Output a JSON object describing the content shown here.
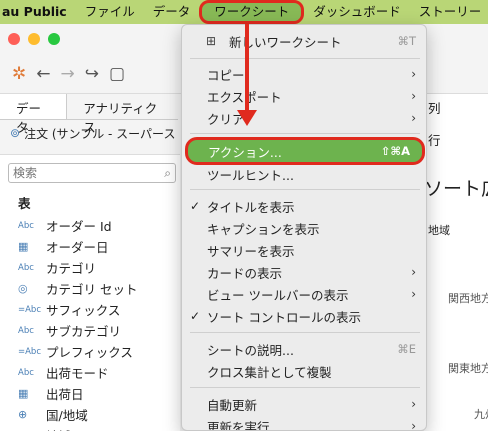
{
  "menubar": {
    "app": "au Public",
    "items": [
      "ファイル",
      "データ",
      "ワークシート",
      "ダッシュボード",
      "ストーリー",
      "ク"
    ]
  },
  "tabs": [
    "データ",
    "アナリティクス"
  ],
  "datasource": "注文 (サンプル - スーパース",
  "search": {
    "placeholder": "検索"
  },
  "section": "表",
  "fields": [
    {
      "type": "Abc",
      "name": "オーダー Id"
    },
    {
      "type": "date",
      "name": "オーダー日"
    },
    {
      "type": "Abc",
      "name": "カテゴリ"
    },
    {
      "type": "set",
      "name": "カテゴリ セット"
    },
    {
      "type": "=Abc",
      "name": "サフィックス"
    },
    {
      "type": "Abc",
      "name": "サブカテゴリ"
    },
    {
      "type": "=Abc",
      "name": "プレフィックス"
    },
    {
      "type": "Abc",
      "name": "出荷モード"
    },
    {
      "type": "date",
      "name": "出荷日"
    },
    {
      "type": "Abc",
      "name": "国/地域"
    },
    {
      "type": "Abc",
      "name": "地域"
    }
  ],
  "right": {
    "col_label": "列",
    "row_label": "行",
    "title": "ソート広",
    "header": "地域",
    "rows": [
      "関西地方",
      "関東地方",
      "九州"
    ]
  },
  "menu": {
    "items": [
      {
        "label": "新しいワークシート",
        "shortcut": "⌘T",
        "icon": "new-sheet"
      },
      {
        "label": "コピー",
        "submenu": true
      },
      {
        "label": "エクスポート",
        "submenu": true
      },
      {
        "label": "クリア",
        "submenu": true
      },
      {
        "label": "アクション...",
        "shortcut": "⇧⌘A",
        "highlighted": true
      },
      {
        "label": "ツールヒント..."
      },
      {
        "label": "タイトルを表示",
        "checked": true
      },
      {
        "label": "キャプションを表示"
      },
      {
        "label": "サマリーを表示"
      },
      {
        "label": "カードの表示",
        "submenu": true
      },
      {
        "label": "ビュー ツールバーの表示",
        "submenu": true
      },
      {
        "label": "ソート コントロールの表示",
        "checked": true
      },
      {
        "label": "シートの説明...",
        "shortcut": "⌘E"
      },
      {
        "label": "クロス集計として複製"
      },
      {
        "label": "自動更新",
        "submenu": true
      },
      {
        "label": "更新を実行",
        "submenu": true
      }
    ]
  },
  "colors": {
    "menubar": "#b9d676",
    "highlight": "#6db34e",
    "annotation": "#e02a1e"
  }
}
